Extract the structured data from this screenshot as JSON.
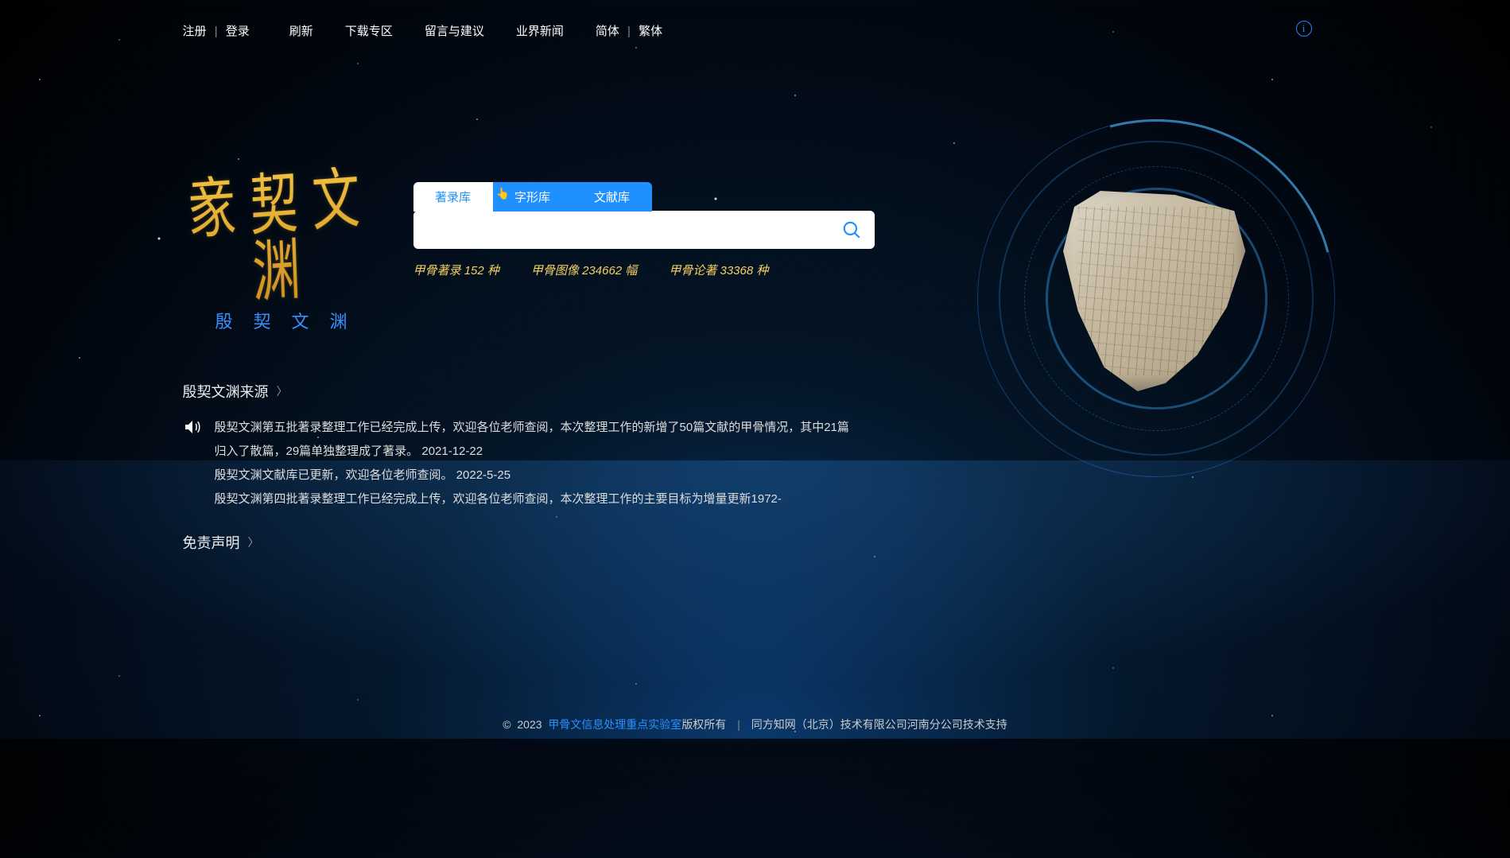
{
  "nav": {
    "register": "注册",
    "login": "登录",
    "refresh": "刷新",
    "download": "下载专区",
    "feedback": "留言与建议",
    "news": "业界新闻",
    "simplified": "简体",
    "traditional": "繁体"
  },
  "logo": {
    "glyphs": "豙契文渊",
    "text": "殷契文渊"
  },
  "tabs": {
    "catalog": "著录库",
    "glyph": "字形库",
    "literature": "文献库"
  },
  "search": {
    "placeholder": ""
  },
  "stats": {
    "s1_label": "甲骨著录",
    "s1_value": "152 种",
    "s2_label": "甲骨图像",
    "s2_value": "234662 幅",
    "s3_label": "甲骨论著",
    "s3_value": "33368 种"
  },
  "source": {
    "title": "殷契文渊来源",
    "line1": "殷契文渊第五批著录整理工作已经完成上传，欢迎各位老师查阅，本次整理工作的新增了50篇文献的甲骨情况，其中21篇归入了散篇，29篇单独整理成了著录。 2021-12-22",
    "line2": "殷契文渊文献库已更新，欢迎各位老师查阅。    2022-5-25",
    "line3": "殷契文渊第四批著录整理工作已经完成上传，欢迎各位老师查阅，本次整理工作的主要目标为增量更新1972-"
  },
  "disclaimer": {
    "title": "免责声明"
  },
  "footer": {
    "copyright": "©",
    "year": "2023",
    "lab": "甲骨文信息处理重点实验室",
    "rights": "版权所有",
    "support": "同方知网（北京）技术有限公司河南分公司技术支持"
  },
  "icons": {
    "info": "i",
    "cursor": "👆"
  }
}
